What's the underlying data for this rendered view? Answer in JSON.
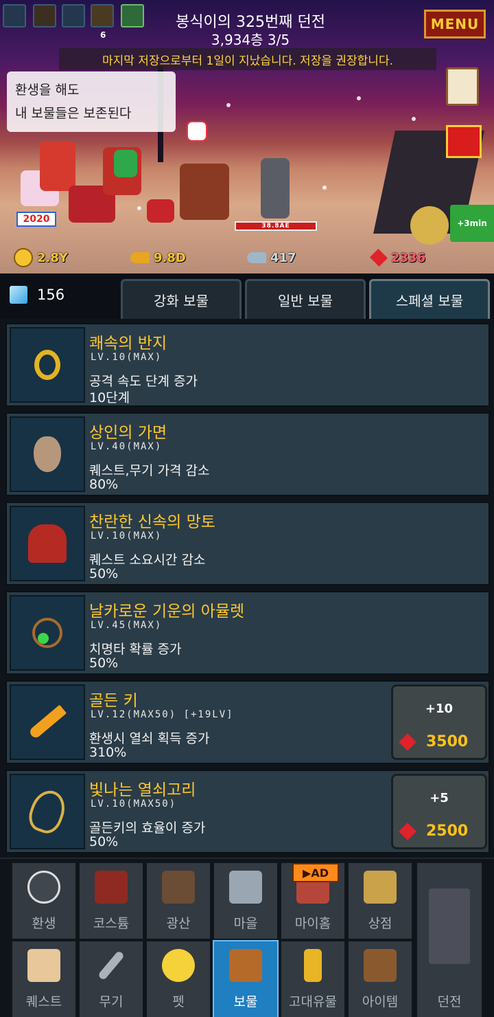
{
  "header": {
    "dungeon_title": "봉식이의 325번째 던전",
    "floor": "3,934층 3/5",
    "menu_label": "MENU",
    "save_warning": "마지막 저장으로부터 1일이 지났습니다. 저장을 권장합니다.",
    "speech_line1": "환생을 해도",
    "speech_line2": "내 보물들은 보존된다",
    "top_icon_count": "6",
    "year_badge": "2020",
    "boss_hp": "38.8AE",
    "bonus_label": "+3min"
  },
  "currencies": {
    "gold": "2.8Y",
    "gold_key": "9.8D",
    "silver_key": "417",
    "ruby": "2336"
  },
  "tabs": {
    "gem_count": "156",
    "items": [
      "강화 보물",
      "일반 보물",
      "스페셜 보물"
    ],
    "active_index": 2
  },
  "treasures": [
    {
      "name": "쾌속의 반지",
      "level": "LV.10(MAX)",
      "effect": "공격 속도 단계 증가",
      "value": "10단계",
      "icon": "ring-icon"
    },
    {
      "name": "상인의 가면",
      "level": "LV.40(MAX)",
      "effect": "퀘스트,무기 가격 감소",
      "value": "80%",
      "icon": "mask-icon"
    },
    {
      "name": "찬란한 신속의 망토",
      "level": "LV.10(MAX)",
      "effect": "퀘스트 소요시간 감소",
      "value": "50%",
      "icon": "cloak-icon"
    },
    {
      "name": "날카로운 기운의 아뮬렛",
      "level": "LV.45(MAX)",
      "effect": "치명타 확률 증가",
      "value": "50%",
      "icon": "amulet-icon"
    },
    {
      "name": "골든 키",
      "level": "LV.12(MAX50) [+19LV]",
      "effect": "환생시 열쇠 획득 증가",
      "value": "310%",
      "icon": "golden-key-icon",
      "upgrade": {
        "plus": "+10",
        "cost": "3500"
      }
    },
    {
      "name": "빛나는 열쇠고리",
      "level": "LV.10(MAX50)",
      "effect": "골든키의 효율이 증가",
      "value": "50%",
      "icon": "keyring-icon",
      "upgrade": {
        "plus": "+5",
        "cost": "2500"
      }
    }
  ],
  "nav": {
    "ad_label": "AD",
    "row1": [
      "환생",
      "코스튬",
      "광산",
      "마을",
      "마이홈",
      "상점"
    ],
    "row2": [
      "퀘스트",
      "무기",
      "펫",
      "보물",
      "고대유물",
      "아이템"
    ],
    "dungeon": "던전",
    "active": "보물"
  },
  "colors": {
    "treasure_name": "#ffc82c",
    "card_bg": "#2a3c48",
    "active_nav": "#1f7fc1",
    "menu_bg": "#8c1a11"
  }
}
